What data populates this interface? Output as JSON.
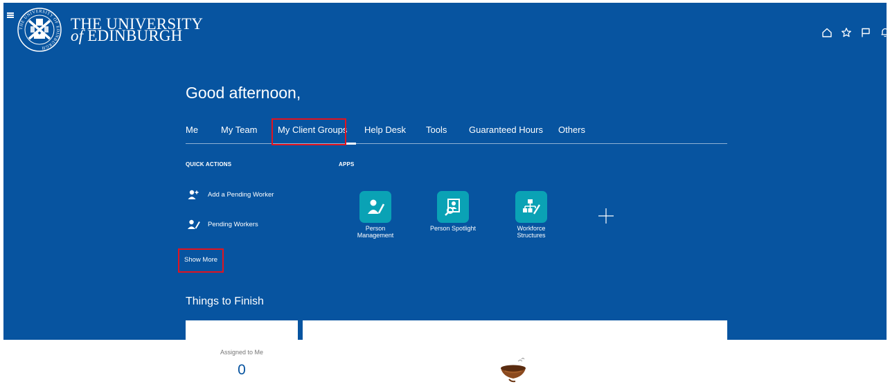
{
  "header": {
    "logo_line1": "THE UNIVERSITY",
    "logo_of": "of",
    "logo_line2": "EDINBURGH",
    "crest_text": "THE UNIVERSITY OF EDINBURGH",
    "icons": [
      "home-icon",
      "star-icon",
      "flag-icon",
      "bell-icon"
    ]
  },
  "greeting": "Good afternoon,",
  "tabs": [
    {
      "label": "Me"
    },
    {
      "label": "My Team"
    },
    {
      "label": "My Client Groups",
      "active": true
    },
    {
      "label": "Help Desk"
    },
    {
      "label": "Tools"
    },
    {
      "label": "Guaranteed Hours"
    },
    {
      "label": "Others"
    }
  ],
  "quick_actions": {
    "heading": "QUICK ACTIONS",
    "items": [
      {
        "label": "Add a Pending Worker",
        "icon": "add-person-icon"
      },
      {
        "label": "Pending Workers",
        "icon": "person-edit-icon"
      }
    ],
    "show_more": "Show More"
  },
  "apps": {
    "heading": "APPS",
    "items": [
      {
        "label": "Person Management",
        "icon": "person-edit-icon"
      },
      {
        "label": "Person Spotlight",
        "icon": "person-spotlight-icon"
      },
      {
        "label": "Workforce Structures",
        "icon": "org-structure-icon"
      }
    ],
    "add_icon": "plus-icon"
  },
  "things_to_finish": {
    "title": "Things to Finish",
    "assigned_label": "Assigned to Me",
    "assigned_count": "0"
  },
  "colors": {
    "banner": "#0754a0",
    "app_tile": "#0aa2b5",
    "highlight": "#e2131f"
  }
}
